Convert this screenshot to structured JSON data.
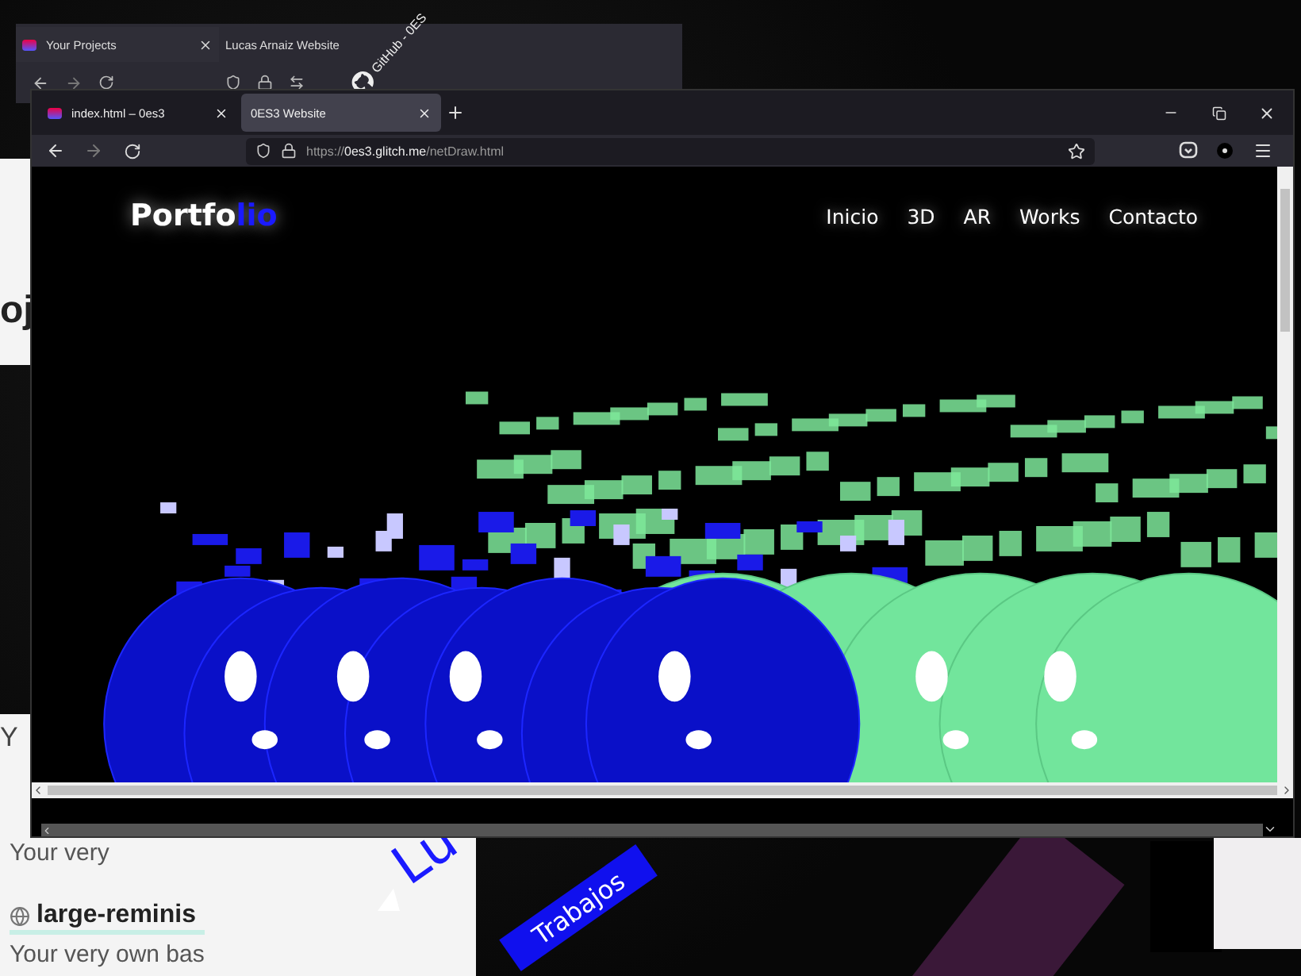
{
  "left_panel": {
    "heading_fragment": "oj",
    "line_fragment": "Y",
    "items": [
      {
        "description": "Your very"
      },
      {
        "title": "large-reminis",
        "description": "Your very own bas"
      }
    ]
  },
  "background_window": {
    "tabs": [
      {
        "label": "Your Projects",
        "selected": true
      },
      {
        "label": "Lucas Arnaiz Website",
        "selected": false
      }
    ]
  },
  "github_caption": "GitHub - 0ES",
  "main_window": {
    "tabs": [
      {
        "label": "index.html – 0es3",
        "selected": false
      },
      {
        "label": "0ES3 Website",
        "selected": true
      }
    ],
    "url": {
      "scheme": "https://",
      "host": "0es3.glitch.me",
      "path": "/netDraw.html"
    }
  },
  "site": {
    "logo": {
      "text": "Portfo",
      "accent": "lio"
    },
    "nav": [
      "Inicio",
      "3D",
      "AR",
      "Works",
      "Contacto"
    ]
  },
  "backdrop": {
    "label": "Trabajos",
    "title_fragment": "Lu"
  }
}
